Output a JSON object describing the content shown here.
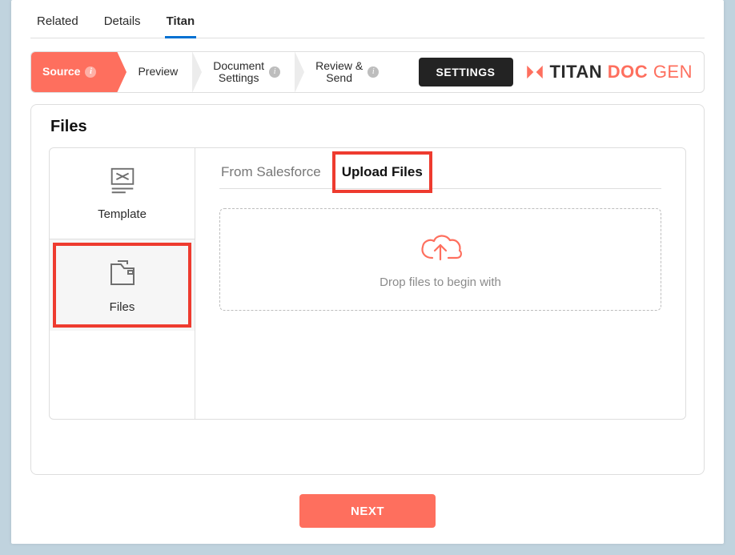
{
  "sf_tabs": {
    "related": "Related",
    "details": "Details",
    "titan": "Titan"
  },
  "wizard": {
    "source": "Source",
    "preview": "Preview",
    "doc_settings": "Document\nSettings",
    "review_send": "Review &\nSend",
    "settings_btn": "SETTINGS"
  },
  "brand": {
    "titan": "TITAN",
    "doc": "DOC",
    "gen": "GEN"
  },
  "panel_title": "Files",
  "side": {
    "template": "Template",
    "files": "Files"
  },
  "subtabs": {
    "from_sf": "From Salesforce",
    "upload": "Upload Files"
  },
  "dropzone_text": "Drop files to begin with",
  "next_btn": "NEXT"
}
